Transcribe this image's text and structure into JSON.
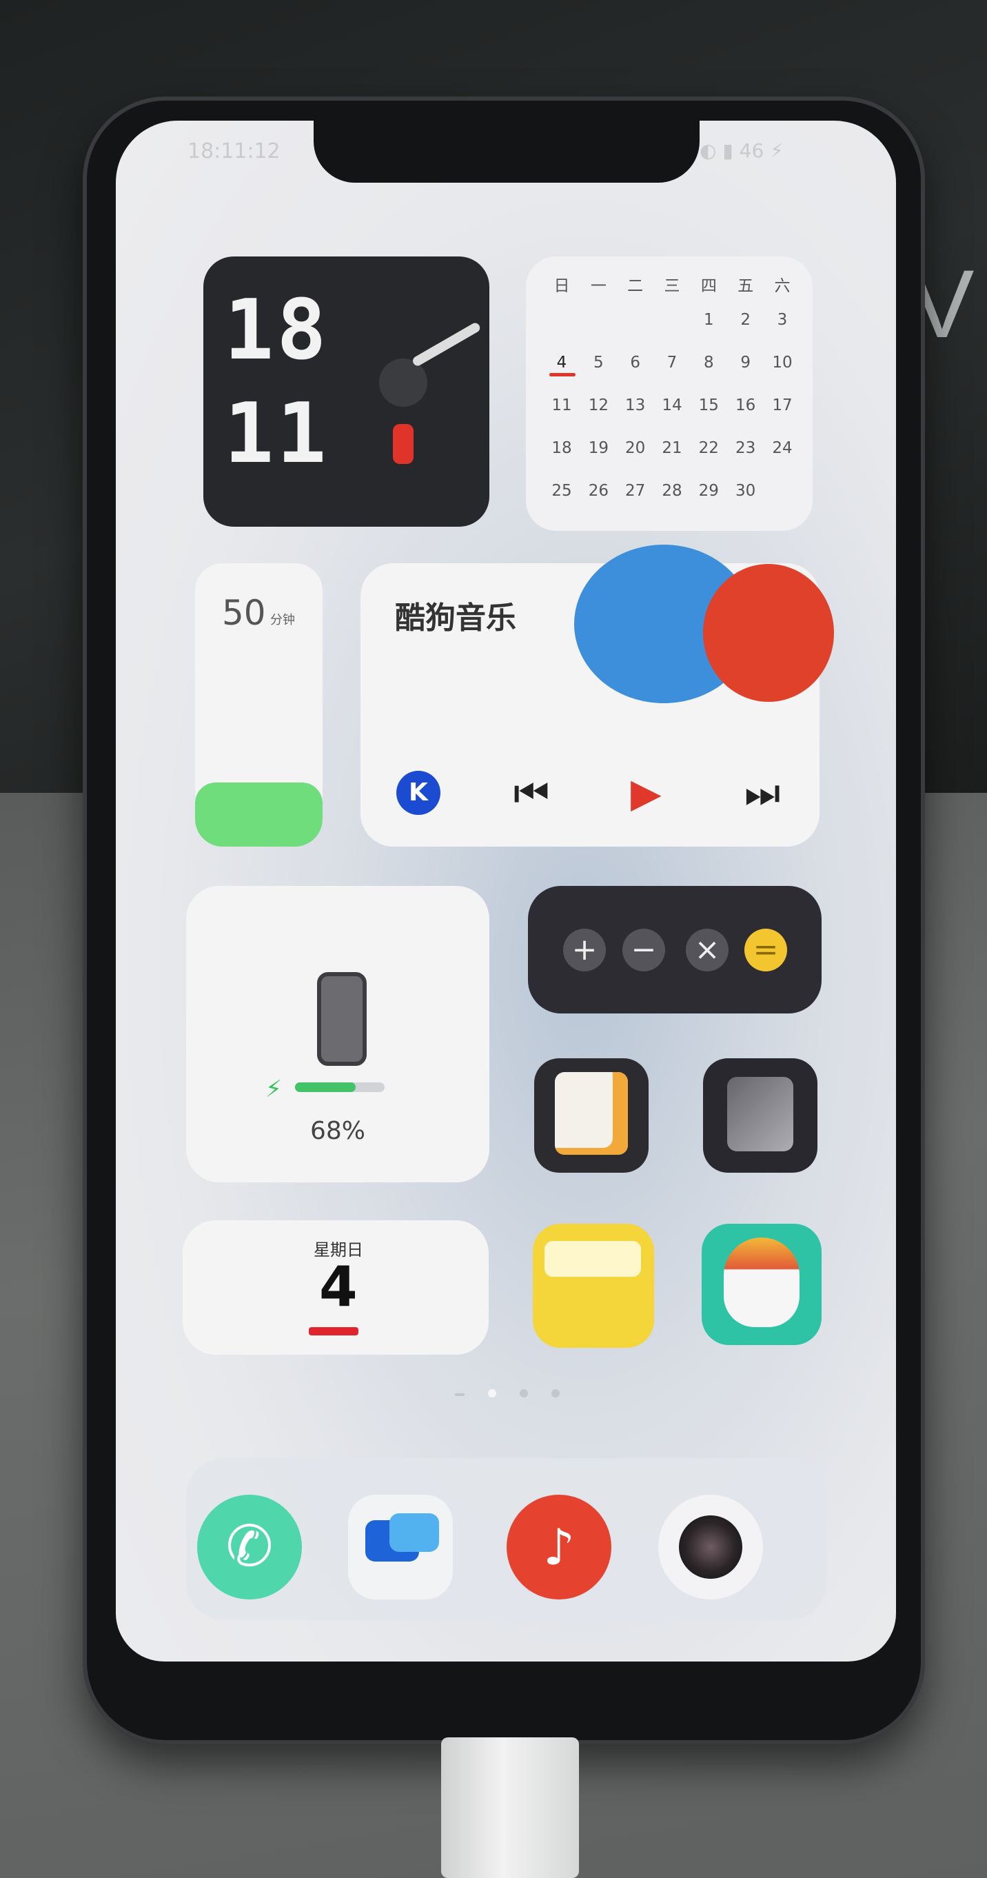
{
  "status_bar": {
    "time": "18:11:12",
    "right_indicators": "◐ ▮ 46 ⚡"
  },
  "backdrop": {
    "mark_text": "V"
  },
  "clock_widget": {
    "hour": "18",
    "minute": "11"
  },
  "calendar_widget": {
    "weekdays": [
      "日",
      "一",
      "二",
      "三",
      "四",
      "五",
      "六"
    ],
    "weeks": [
      [
        "",
        "",
        "",
        "",
        "1",
        "2",
        "3"
      ],
      [
        "4",
        "5",
        "6",
        "7",
        "8",
        "9",
        "10"
      ],
      [
        "11",
        "12",
        "13",
        "14",
        "15",
        "16",
        "17"
      ],
      [
        "18",
        "19",
        "20",
        "21",
        "22",
        "23",
        "24"
      ],
      [
        "25",
        "26",
        "27",
        "28",
        "29",
        "30",
        ""
      ]
    ],
    "today": "4",
    "accent_color": "#e0342a"
  },
  "screen_time_widget": {
    "value": "50",
    "unit": "分钟"
  },
  "music_widget": {
    "title": "酷狗音乐",
    "logo_letter": "K",
    "prev_icon": "⏮",
    "play_icon": "▶",
    "next_icon": "⏭"
  },
  "battery_widget": {
    "percent_text": "68%",
    "level": 0.68,
    "bolt": "⚡"
  },
  "calculator_widget": {
    "buttons": [
      "+",
      "−",
      "×",
      "="
    ]
  },
  "date_widget": {
    "weekday": "星期日",
    "day": "4"
  },
  "page_indicator": {
    "pages": 4,
    "active_index": 1
  },
  "dock": {
    "phone_glyph": "✆",
    "music_glyph": "♪",
    "apps": [
      "phone-icon",
      "messages-icon",
      "music-icon",
      "camera-icon"
    ]
  },
  "colors": {
    "music_play": "#e0392b",
    "battery_fill": "#43c26a",
    "calc_equals": "#f3c62f",
    "phone_app": "#4fd6ab"
  }
}
